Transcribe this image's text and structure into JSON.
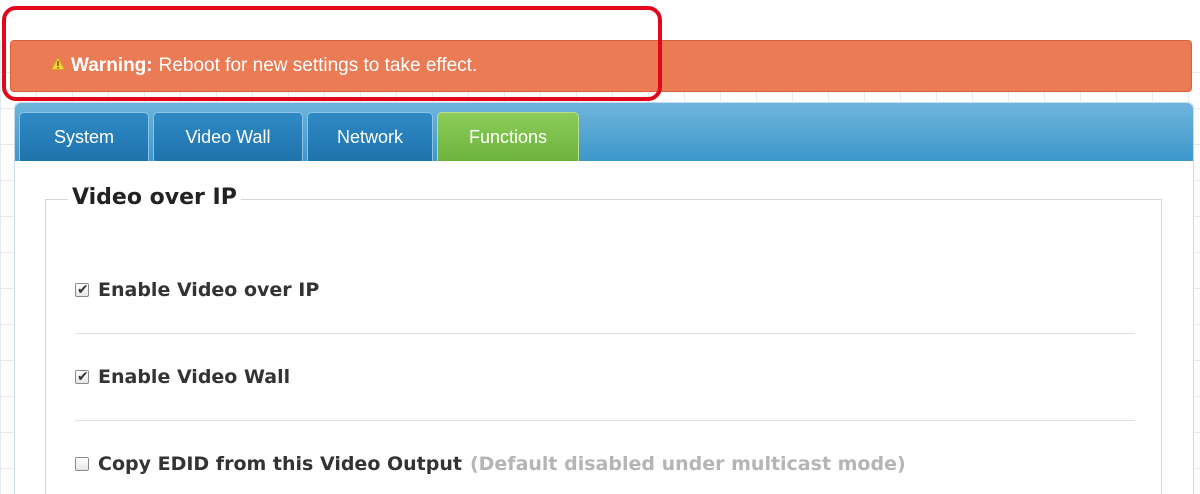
{
  "warning": {
    "label": "Warning:",
    "message": "Reboot for new settings to take effect.",
    "icon": "warning-triangle-icon",
    "color": "#ea7b55"
  },
  "tabs": [
    {
      "label": "System",
      "active": false
    },
    {
      "label": "Video Wall",
      "active": false
    },
    {
      "label": "Network",
      "active": false
    },
    {
      "label": "Functions",
      "active": true
    }
  ],
  "section": {
    "title": "Video over IP",
    "options": [
      {
        "label": "Enable Video over IP",
        "checked": true,
        "hint": ""
      },
      {
        "label": "Enable Video Wall",
        "checked": true,
        "hint": ""
      },
      {
        "label": "Copy EDID from this Video Output",
        "checked": false,
        "hint": "(Default disabled under multicast mode)"
      }
    ]
  },
  "colors": {
    "tab_blue": "#2f8ac4",
    "tab_active_green": "#6cb33c",
    "highlight_red": "#e3071b"
  }
}
